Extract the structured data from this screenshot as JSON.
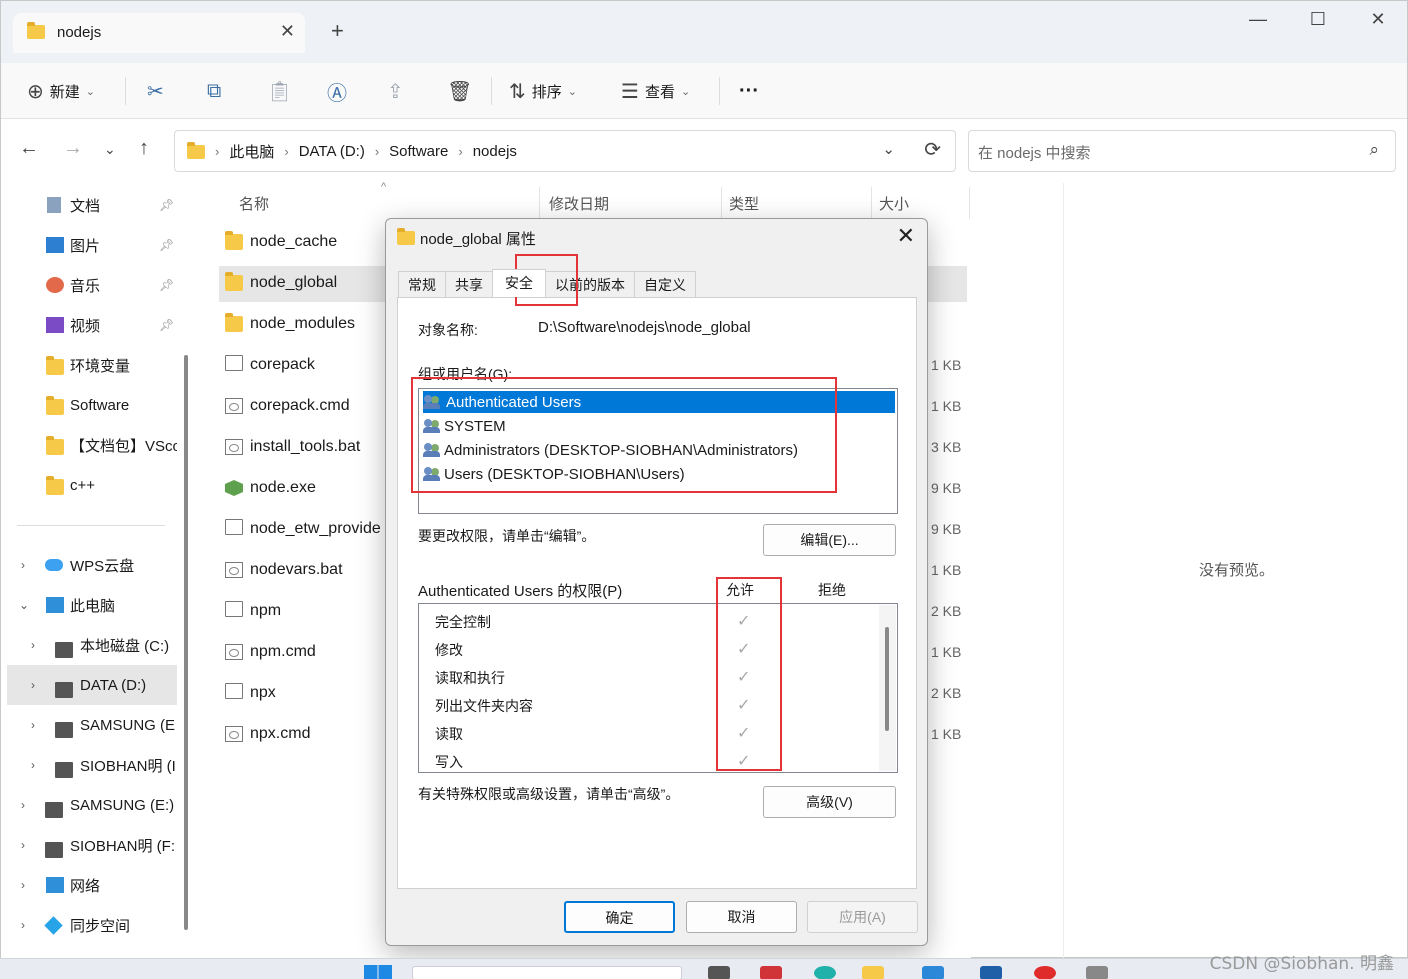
{
  "window": {
    "tab_title": "nodejs",
    "new_tab": "+",
    "controls": {
      "minimize": "—",
      "maximize": "☐",
      "close": "✕"
    }
  },
  "toolbar": {
    "new_label": "新建",
    "sort_label": "排序",
    "view_label": "查看",
    "more_label": "···"
  },
  "address": {
    "crumbs": [
      "此电脑",
      "DATA (D:)",
      "Software",
      "nodejs"
    ],
    "search_placeholder": "在 nodejs 中搜索"
  },
  "sidebar": {
    "items": [
      {
        "label": "文档",
        "icon": "documents-icon",
        "pinned": true
      },
      {
        "label": "图片",
        "icon": "pictures-icon",
        "pinned": true
      },
      {
        "label": "音乐",
        "icon": "music-icon",
        "pinned": true
      },
      {
        "label": "视频",
        "icon": "videos-icon",
        "pinned": true
      },
      {
        "label": "环境变量",
        "icon": "folder-icon"
      },
      {
        "label": "Software",
        "icon": "folder-icon"
      },
      {
        "label": "【文档包】VSco",
        "icon": "folder-icon"
      },
      {
        "label": "c++",
        "icon": "folder-icon"
      },
      {
        "label": "WPS云盘",
        "icon": "cloud-icon"
      },
      {
        "label": "此电脑",
        "icon": "computer-icon"
      },
      {
        "label": "本地磁盘 (C:)",
        "icon": "drive-icon"
      },
      {
        "label": "DATA (D:)",
        "icon": "drive-icon"
      },
      {
        "label": "SAMSUNG (E",
        "icon": "drive-icon"
      },
      {
        "label": "SIOBHAN明 (I",
        "icon": "drive-icon"
      },
      {
        "label": "SAMSUNG (E:)",
        "icon": "drive-icon"
      },
      {
        "label": "SIOBHAN明 (F:",
        "icon": "drive-icon"
      },
      {
        "label": "网络",
        "icon": "network-icon"
      },
      {
        "label": "同步空间",
        "icon": "sync-icon"
      }
    ]
  },
  "filelist": {
    "columns": [
      "名称",
      "修改日期",
      "类型",
      "大小"
    ],
    "rows": [
      {
        "name": "node_cache",
        "size": "",
        "icon": "folder-icon"
      },
      {
        "name": "node_global",
        "size": "",
        "icon": "folder-icon"
      },
      {
        "name": "node_modules",
        "size": "",
        "icon": "folder-icon"
      },
      {
        "name": "corepack",
        "size": "1 KB",
        "icon": "file-icon"
      },
      {
        "name": "corepack.cmd",
        "size": "1 KB",
        "icon": "cmd-icon"
      },
      {
        "name": "install_tools.bat",
        "size": "3 KB",
        "icon": "cmd-icon"
      },
      {
        "name": "node.exe",
        "size": "9 KB",
        "icon": "node-icon"
      },
      {
        "name": "node_etw_provide",
        "size": "9 KB",
        "icon": "file-icon"
      },
      {
        "name": "nodevars.bat",
        "size": "1 KB",
        "icon": "cmd-icon"
      },
      {
        "name": "npm",
        "size": "2 KB",
        "icon": "file-icon"
      },
      {
        "name": "npm.cmd",
        "size": "1 KB",
        "icon": "cmd-icon"
      },
      {
        "name": "npx",
        "size": "2 KB",
        "icon": "file-icon"
      },
      {
        "name": "npx.cmd",
        "size": "1 KB",
        "icon": "cmd-icon"
      }
    ]
  },
  "preview": {
    "message": "没有预览。"
  },
  "dialog": {
    "title": "node_global 属性",
    "tabs": [
      "常规",
      "共享",
      "安全",
      "以前的版本",
      "自定义"
    ],
    "active_tab": "安全",
    "object_label": "对象名称:",
    "object_value": "D:\\Software\\nodejs\\node_global",
    "groups_label": "组或用户名(G):",
    "groups": [
      "Authenticated Users",
      "SYSTEM",
      "Administrators (DESKTOP-SIOBHAN\\Administrators)",
      "Users (DESKTOP-SIOBHAN\\Users)"
    ],
    "change_hint": "要更改权限，请单击“编辑”。",
    "edit_button": "编辑(E)...",
    "perm_label": "Authenticated Users 的权限(P)",
    "allow_header": "允许",
    "deny_header": "拒绝",
    "permissions": [
      {
        "name": "完全控制",
        "allow": "✓"
      },
      {
        "name": "修改",
        "allow": "✓"
      },
      {
        "name": "读取和执行",
        "allow": "✓"
      },
      {
        "name": "列出文件夹内容",
        "allow": "✓"
      },
      {
        "name": "读取",
        "allow": "✓"
      },
      {
        "name": "写入",
        "allow": "✓"
      }
    ],
    "advanced_hint": "有关特殊权限或高级设置，请单击“高级”。",
    "advanced_button": "高级(V)",
    "ok_button": "确定",
    "cancel_button": "取消",
    "apply_button": "应用(A)"
  },
  "watermark": "CSDN @Siobhan. 明鑫",
  "colors": {
    "accent": "#0078d7",
    "highlight": "#e3343a",
    "folder": "#f7c948"
  }
}
